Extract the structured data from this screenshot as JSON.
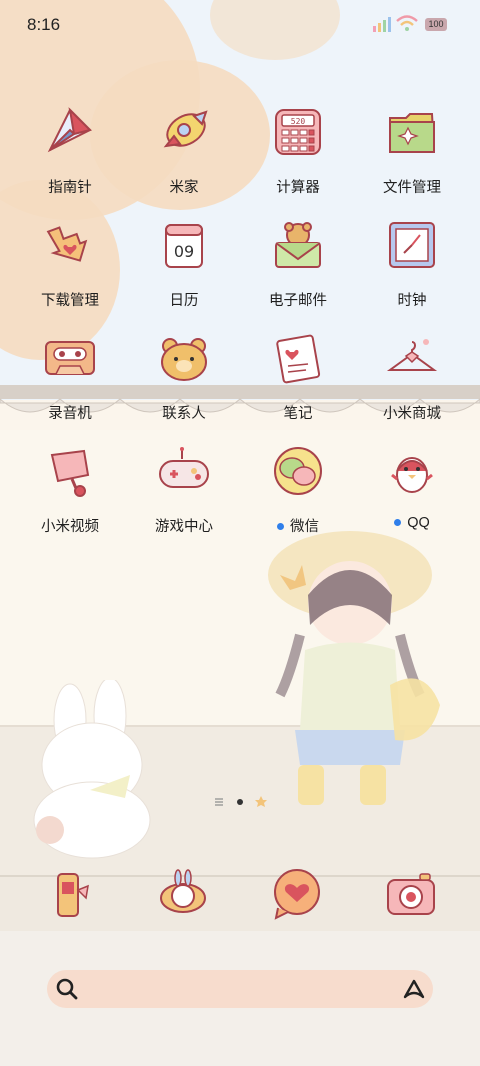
{
  "status_bar": {
    "time": "8:16",
    "battery": "100"
  },
  "apps": [
    {
      "label": "指南针",
      "icon": "compass-icon",
      "badge": false
    },
    {
      "label": "米家",
      "icon": "mijia-rocket-icon",
      "badge": false
    },
    {
      "label": "计算器",
      "icon": "calculator-icon",
      "badge": false
    },
    {
      "label": "文件管理",
      "icon": "folder-icon",
      "badge": false
    },
    {
      "label": "下载管理",
      "icon": "download-arrow-icon",
      "badge": false
    },
    {
      "label": "日历",
      "icon": "calendar-icon",
      "badge": false,
      "day": "09"
    },
    {
      "label": "电子邮件",
      "icon": "bear-envelope-icon",
      "badge": false
    },
    {
      "label": "时钟",
      "icon": "clock-icon",
      "badge": false
    },
    {
      "label": "录音机",
      "icon": "cassette-icon",
      "badge": false
    },
    {
      "label": "联系人",
      "icon": "bear-face-icon",
      "badge": false
    },
    {
      "label": "笔记",
      "icon": "notepad-icon",
      "badge": false
    },
    {
      "label": "小米商城",
      "icon": "hanger-icon",
      "badge": false
    },
    {
      "label": "小米视频",
      "icon": "camera-icon",
      "badge": false
    },
    {
      "label": "游戏中心",
      "icon": "gamepad-icon",
      "badge": false
    },
    {
      "label": "微信",
      "icon": "chat-bubbles-icon",
      "badge": true
    },
    {
      "label": "QQ",
      "icon": "penguin-icon",
      "badge": true
    }
  ],
  "calculator_display": "520",
  "dock": [
    {
      "icon": "phone-icon"
    },
    {
      "icon": "bunny-browser-icon"
    },
    {
      "icon": "heart-message-icon"
    },
    {
      "icon": "photo-camera-icon"
    }
  ],
  "search": {
    "placeholder": ""
  },
  "colors": {
    "accent": "#2f7fea",
    "search_bg": "#f7dccd",
    "icon_red": "#d9545e",
    "icon_outline": "#a8434b"
  }
}
